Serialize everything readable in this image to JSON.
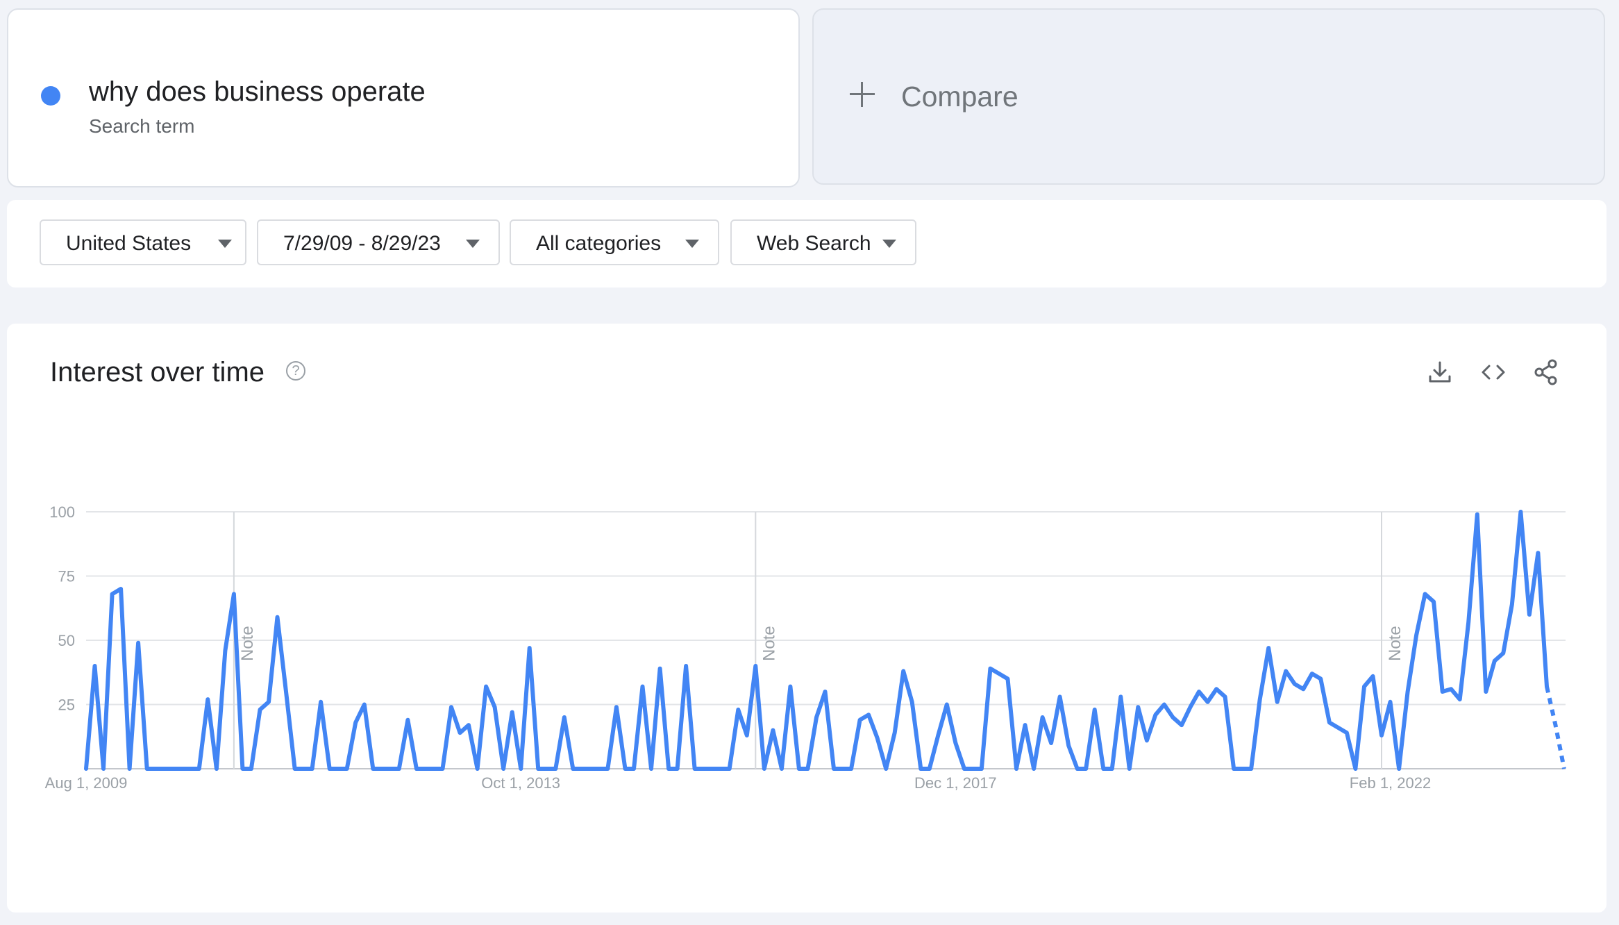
{
  "search_term": {
    "name": "why does business operate",
    "subtitle": "Search term",
    "color": "#4285f4"
  },
  "compare": {
    "label": "Compare"
  },
  "filters": {
    "region": "United States",
    "date_range": "7/29/09 - 8/29/23",
    "category": "All categories",
    "search_type": "Web Search"
  },
  "chart": {
    "title": "Interest over time",
    "help_symbol": "?"
  },
  "icons": [
    "help-icon",
    "download-icon",
    "embed-code-icon",
    "share-icon",
    "chevron-down-icon",
    "plus-icon"
  ],
  "chart_data": {
    "type": "line",
    "title": "Interest over time",
    "series": [
      {
        "name": "why does business operate",
        "color": "#4285f4",
        "values": [
          0,
          40,
          0,
          68,
          70,
          0,
          49,
          0,
          0,
          0,
          0,
          0,
          0,
          0,
          27,
          0,
          46,
          68,
          0,
          0,
          23,
          26,
          59,
          30,
          0,
          0,
          0,
          26,
          0,
          0,
          0,
          18,
          25,
          0,
          0,
          0,
          0,
          19,
          0,
          0,
          0,
          0,
          24,
          14,
          17,
          0,
          32,
          24,
          0,
          22,
          0,
          47,
          0,
          0,
          0,
          20,
          0,
          0,
          0,
          0,
          0,
          24,
          0,
          0,
          32,
          0,
          39,
          0,
          0,
          40,
          0,
          0,
          0,
          0,
          0,
          23,
          13,
          40,
          0,
          15,
          0,
          32,
          0,
          0,
          20,
          30,
          0,
          0,
          0,
          19,
          21,
          12,
          0,
          14,
          38,
          26,
          0,
          0,
          13,
          25,
          10,
          0,
          0,
          0,
          39,
          37,
          35,
          0,
          17,
          0,
          20,
          10,
          28,
          9,
          0,
          0,
          23,
          0,
          0,
          28,
          0,
          24,
          11,
          21,
          25,
          20,
          17,
          24,
          30,
          26,
          31,
          28,
          0,
          0,
          0,
          27,
          47,
          26,
          38,
          33,
          31,
          37,
          35,
          18,
          16,
          14,
          0,
          32,
          36,
          13,
          26,
          0,
          30,
          52,
          68,
          65,
          30,
          31,
          27,
          57,
          99,
          30,
          42,
          45,
          64,
          100,
          60,
          84,
          32,
          17,
          0
        ]
      }
    ],
    "partial_from_index": 168,
    "x_start": "2009-08-01",
    "x_step": "month",
    "x_ticks": [
      {
        "label": "Aug 1, 2009",
        "index": 0
      },
      {
        "label": "Oct 1, 2013",
        "index": 50
      },
      {
        "label": "Dec 1, 2017",
        "index": 100
      },
      {
        "label": "Feb 1, 2022",
        "index": 150
      }
    ],
    "y_ticks": [
      25,
      50,
      75,
      100
    ],
    "ylim": [
      0,
      100
    ],
    "notes": [
      {
        "label": "Note",
        "index": 17
      },
      {
        "label": "Note",
        "index": 77
      },
      {
        "label": "Note",
        "index": 149
      }
    ],
    "grid": true
  }
}
